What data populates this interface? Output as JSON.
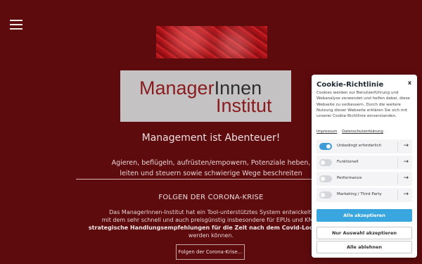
{
  "logo": {
    "word1": "Manager",
    "word2": "Innen",
    "word3": "Institut"
  },
  "hero": {
    "headline": "Management ist Abenteuer!",
    "subline_1": "Agieren, beflügeln, aufrüsten/empowern, Potenziale heben,",
    "subline_2": "leiten und steuern sowie schwierige Wege beschreiten"
  },
  "section": {
    "title": "FOLGEN DER CORONA-KRISE",
    "line_1": "Das ManagerInnen-Institut hat ein Tool-unterstütztes System entwickelt,",
    "line_2": "mit dem sehr schnell und auch preisgünstig insbesondere für EPUs und KMUs",
    "line_3_bold": "strategische Handlungsempfehlungen für die Zeit nach dem Covid-Lockdown",
    "line_4": "werden können.",
    "button_label": "Folgen der Corona-Krise..."
  },
  "cookie": {
    "title": "Cookie-Richtlinie",
    "close": "x",
    "description": "Cookies werden zur Benutzerführung und Webanalyse verwendet und helfen dabei, diese Webseite zu verbessern. Durch die weitere Nutzung dieser Webseite erklären Sie sich mit unserer Cookie-Richtlinie einverstanden.",
    "links": [
      "Impressum",
      "Datenschutzerklärung"
    ],
    "categories": [
      {
        "label": "Unbedingt erforderlich",
        "enabled": true
      },
      {
        "label": "Funktionell",
        "enabled": false
      },
      {
        "label": "Performance",
        "enabled": false
      },
      {
        "label": "Marketing / Third Party",
        "enabled": false
      }
    ],
    "arrow": "→",
    "accept_all": "Alle akzeptieren",
    "accept_selection": "Nur Auswahl akzeptieren",
    "reject_all": "Alle ablehnen"
  },
  "colors": {
    "background": "#5e0b0e",
    "accent": "#3aa6df",
    "logo_maroon": "#8a1b1f"
  },
  "icons": {
    "menu": "hamburger-menu-icon",
    "category_expand": "arrow-right-icon"
  }
}
